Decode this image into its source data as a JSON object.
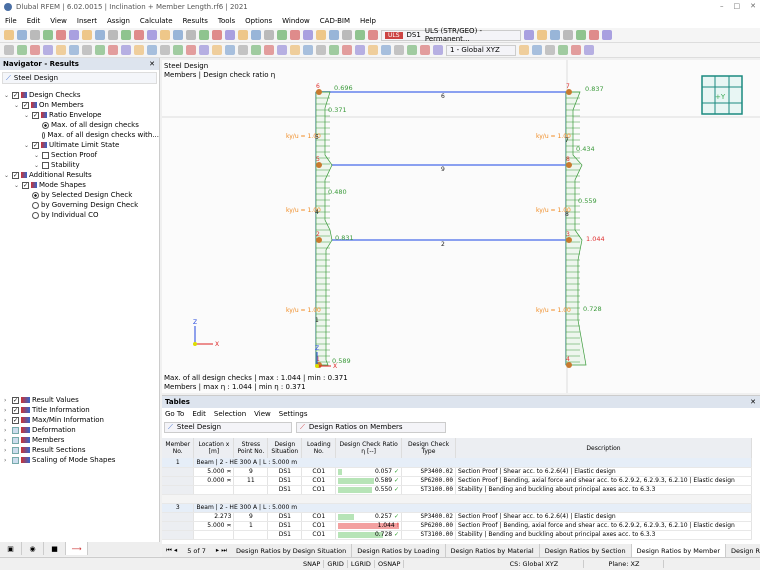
{
  "app": {
    "title": "Dlubal RFEM | 6.02.0015 | Inclination + Member Length.rf6 | 2021"
  },
  "menu": [
    "File",
    "Edit",
    "View",
    "Insert",
    "Assign",
    "Calculate",
    "Results",
    "Tools",
    "Options",
    "Window",
    "CAD-BIM",
    "Help"
  ],
  "toolbar": {
    "ds_badge": "ULS",
    "ds": "DS1",
    "combo": "ULS (STR/GEO) - Permanent...",
    "cs": "1 - Global XYZ"
  },
  "navigator": {
    "title": "Navigator - Results",
    "module": "Steel Design",
    "tree": [
      {
        "label": "Design Checks",
        "lvl": 0,
        "type": "cb",
        "checked": true
      },
      {
        "label": "On Members",
        "lvl": 1,
        "type": "cb",
        "checked": true
      },
      {
        "label": "Ratio Envelope",
        "lvl": 2,
        "type": "cb",
        "checked": true
      },
      {
        "label": "Max. of all design checks",
        "lvl": 3,
        "type": "rb",
        "checked": true
      },
      {
        "label": "Max. of all design checks with...",
        "lvl": 3,
        "type": "rb",
        "checked": false
      },
      {
        "label": "Ultimate Limit State",
        "lvl": 2,
        "type": "cb",
        "checked": true
      },
      {
        "label": "Section Proof",
        "lvl": 3,
        "type": "cb",
        "checked": false
      },
      {
        "label": "Stability",
        "lvl": 3,
        "type": "cb",
        "checked": false
      },
      {
        "label": "Additional Results",
        "lvl": 0,
        "type": "cb",
        "checked": true
      },
      {
        "label": "Mode Shapes",
        "lvl": 1,
        "type": "cb",
        "checked": true
      },
      {
        "label": "by Selected Design Check",
        "lvl": 2,
        "type": "rb",
        "checked": true
      },
      {
        "label": "by Governing Design Check",
        "lvl": 2,
        "type": "rb",
        "checked": false
      },
      {
        "label": "by Individual CO",
        "lvl": 2,
        "type": "rb",
        "checked": false
      }
    ],
    "display": [
      {
        "label": "Result Values",
        "checked": true
      },
      {
        "label": "Title Information",
        "checked": true
      },
      {
        "label": "Max/Min Information",
        "checked": true
      },
      {
        "label": "Deformation",
        "checked": false
      },
      {
        "label": "Members",
        "checked": false
      },
      {
        "label": "Result Sections",
        "checked": false
      },
      {
        "label": "Scaling of Mode Shapes",
        "checked": false
      }
    ]
  },
  "viewport": {
    "title": "Steel Design",
    "subtitle": "Members | Design check ratio η",
    "footer1": "Max. of all design checks | max  : 1.044 | min  : 0.371",
    "footer2": "Members | max η : 1.044 | min η : 0.371",
    "kfactor": "ky/u = 1.00",
    "view_cube": "+Y",
    "values": [
      "0.696",
      "0.371",
      "0.480",
      "0.831",
      "0.589",
      "0.837",
      "0.434",
      "0.559",
      "1.044",
      "0.728"
    ],
    "nodes": [
      "6",
      "5",
      "2",
      "1",
      "7",
      "8",
      "3",
      "4"
    ],
    "members": [
      "5",
      "4",
      "1",
      "7",
      "8",
      "6",
      "9",
      "2"
    ]
  },
  "tables": {
    "title": "Tables",
    "menu": [
      "Go To",
      "Edit",
      "Selection",
      "View",
      "Settings"
    ],
    "module": "Steel Design",
    "table": "Design Ratios on Members",
    "headers": [
      "Member No.",
      "Location x [m]",
      "Stress Point No.",
      "Design Situation",
      "Loading No.",
      "Design Check Ratio η [--]",
      "Design Check Type",
      "Description"
    ],
    "groups": [
      {
        "no": "1",
        "title": "Beam | 2 - HE 300 A | L : 5.000 m",
        "rows": [
          {
            "loc": "5.000 ≍",
            "sp": "9",
            "ds": "DS1",
            "lo": "CO1",
            "ratio": 0.057,
            "rt": "0.057",
            "ok": true,
            "type": "SP3400.02",
            "desc": "Section Proof | Shear acc. to 6.2.6(4) | Elastic design"
          },
          {
            "loc": "0.000 ≍",
            "sp": "11",
            "ds": "DS1",
            "lo": "CO1",
            "ratio": 0.589,
            "rt": "0.589",
            "ok": true,
            "type": "SP6200.00",
            "desc": "Section Proof | Bending, axial force and shear acc. to 6.2.9.2, 6.2.9.3, 6.2.10 | Elastic design"
          },
          {
            "loc": "",
            "sp": "",
            "ds": "DS1",
            "lo": "CO1",
            "ratio": 0.55,
            "rt": "0.550",
            "ok": true,
            "type": "ST3100.00",
            "desc": "Stability | Bending and buckling about principal axes acc. to 6.3.3"
          }
        ]
      },
      {
        "no": "3",
        "title": "Beam | 2 - HE 300 A | L : 5.000 m",
        "rows": [
          {
            "loc": "2.273",
            "sp": "9",
            "ds": "DS1",
            "lo": "CO1",
            "ratio": 0.257,
            "rt": "0.257",
            "ok": true,
            "type": "SP3400.02",
            "desc": "Section Proof | Shear acc. to 6.2.6(4) | Elastic design"
          },
          {
            "loc": "5.000 ≍",
            "sp": "1",
            "ds": "DS1",
            "lo": "CO1",
            "ratio": 1.044,
            "rt": "1.044",
            "ok": false,
            "type": "SP6200.00",
            "desc": "Section Proof | Bending, axial force and shear acc. to 6.2.9.2, 6.2.9.3, 6.2.10 | Elastic design"
          },
          {
            "loc": "",
            "sp": "",
            "ds": "DS1",
            "lo": "CO1",
            "ratio": 0.728,
            "rt": "0.728",
            "ok": true,
            "type": "ST3100.00",
            "desc": "Stability | Bending and buckling about principal axes acc. to 6.3.3"
          }
        ]
      }
    ],
    "pager": "5 of 7",
    "tabs": [
      "Design Ratios by Design Situation",
      "Design Ratios by Loading",
      "Design Ratios by Material",
      "Design Ratios by Section",
      "Design Ratios by Member",
      "Design Ratios by Location",
      "De"
    ],
    "active_tab": 4
  },
  "status": {
    "items": [
      "SNAP",
      "GRID",
      "LGRID",
      "OSNAP"
    ],
    "cs": "CS: Global XYZ",
    "plane": "Plane: XZ"
  },
  "colors": {
    "ok": "#2a9d2a",
    "fail": "#e03030",
    "diagram": "#3a9a3a",
    "beam": "#8aa0f0",
    "kfactor": "#f08a20"
  }
}
